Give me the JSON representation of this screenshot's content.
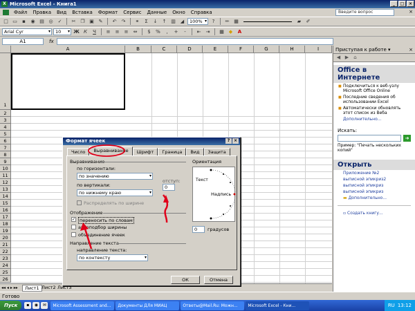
{
  "window": {
    "title": "Microsoft Excel - Книга1"
  },
  "menu": {
    "items": [
      "Файл",
      "Правка",
      "Вид",
      "Вставка",
      "Формат",
      "Сервис",
      "Данные",
      "Окно",
      "Справка"
    ],
    "help_placeholder": "Введите вопрос"
  },
  "toolbar": {
    "zoom": "100%",
    "font_name": "Arial Cyr",
    "font_size": "10"
  },
  "formula_bar": {
    "name_box": "A1",
    "fx": "fx"
  },
  "sheet": {
    "columns": [
      "A",
      "B",
      "C",
      "D",
      "E",
      "F",
      "G",
      "H",
      "I"
    ],
    "rows": [
      "1",
      "2",
      "3",
      "4",
      "5",
      "6",
      "7",
      "8",
      "9",
      "10",
      "11",
      "12",
      "13",
      "14",
      "15",
      "16",
      "17",
      "18",
      "19",
      "20",
      "21",
      "22",
      "23",
      "24",
      "25",
      "26"
    ],
    "tabs": [
      "Лист1",
      "Лист2",
      "Лист3"
    ]
  },
  "status": {
    "text": "Готово"
  },
  "task_pane": {
    "header": "Приступая к работе",
    "office_online": "Office в Интернете",
    "links": [
      "Подключиться к веб-узлу Microsoft Office Online",
      "Последние сведения об использовании Excel",
      "Автоматически обновлять этот список из Веба"
    ],
    "more": "Дополнительно...",
    "search_label": "Искать:",
    "example": "Пример: \"Печать нескольких копий\"",
    "open_section": "Открыть",
    "files": [
      "Приложение №2",
      "выписной эпикриз2",
      "выписной эпикриз",
      "выписной эпикриз"
    ],
    "more2": "Дополнительно...",
    "create": "Создать книгу..."
  },
  "dialog": {
    "title": "Формат ячеек",
    "tabs": [
      "Число",
      "Выравнивание",
      "Шрифт",
      "Граница",
      "Вид",
      "Защита"
    ],
    "align_label": "Выравнивание",
    "horiz_label": "по горизонтали:",
    "horiz_value": "по значению",
    "indent_label": "отступ:",
    "indent_value": "0",
    "vert_label": "по вертикали:",
    "vert_value": "по нижнему краю",
    "distribute": "Распределять по ширине",
    "display_label": "Отображение",
    "wrap": "переносить по словам",
    "shrink": "автоподбор ширины",
    "merge": "объединение ячеек",
    "direction_label": "Направление текста",
    "direction_sub": "направление текста:",
    "direction_value": "по контексту",
    "orientation_label": "Ориентация",
    "vertical_text": "Текст",
    "sample_label": "Надпись",
    "degrees_value": "0",
    "degrees_label": "градусов",
    "ok": "ОК",
    "cancel": "Отмена"
  },
  "taskbar": {
    "start": "Пуск",
    "tasks": [
      "Microsoft Assessment and...",
      "Документы ДЛя МИАЦ",
      "Ответы@Mail.Ru: Можн...",
      "Microsoft Excel - Кни..."
    ],
    "lang": "RU",
    "clock": "13:12"
  },
  "colors": {
    "title": "#0a246a",
    "annotation": "#e0001a"
  }
}
